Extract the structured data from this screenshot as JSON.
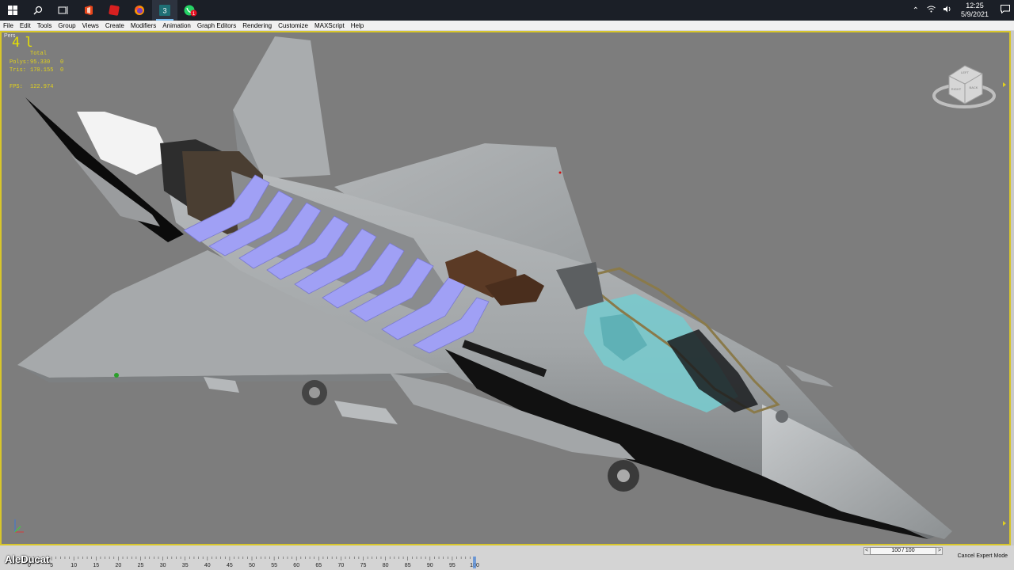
{
  "menu": [
    "File",
    "Edit",
    "Tools",
    "Group",
    "Views",
    "Create",
    "Modifiers",
    "Animation",
    "Graph Editors",
    "Rendering",
    "Customize",
    "MAXScript",
    "Help"
  ],
  "taskbar": {
    "clock_time": "12:25",
    "clock_date": "5/9/2021",
    "notification_badge": "1",
    "apps": [
      "start-icon",
      "search-icon",
      "task-view-icon",
      "office-icon",
      "red-app-icon",
      "firefox-icon",
      "3dsmax-icon",
      "whatsapp-icon"
    ]
  },
  "viewport": {
    "label": "Pers",
    "big_number": "4 l",
    "stats": {
      "total_label": "Total",
      "polys_label": "Polys:",
      "polys_value": "95.330",
      "polys_selected": "0",
      "tris_label": "Tris:",
      "tris_value": "170.155",
      "tris_selected": "0",
      "fps_label": "FPS:",
      "fps_value": "122.974"
    },
    "viewcube_labels": [
      "LEFT",
      "RIGHT",
      "BACK"
    ]
  },
  "timeslider": {
    "label": "100 / 100",
    "prev_arrow": "<",
    "next_arrow": ">",
    "ticks": [
      "0",
      "5",
      "10",
      "15",
      "20",
      "25",
      "30",
      "35",
      "40",
      "45",
      "50",
      "55",
      "60",
      "65",
      "70",
      "75",
      "80",
      "85",
      "90",
      "95",
      "100"
    ]
  },
  "status": {
    "expert_mode": "Cancel Expert Mode"
  },
  "watermark": "AleDucat",
  "colors": {
    "viewport_bg": "#7d7d7d",
    "active_border": "#d8c62a",
    "stats_text": "#e2d21a",
    "taskbar": "#1b1f27"
  }
}
